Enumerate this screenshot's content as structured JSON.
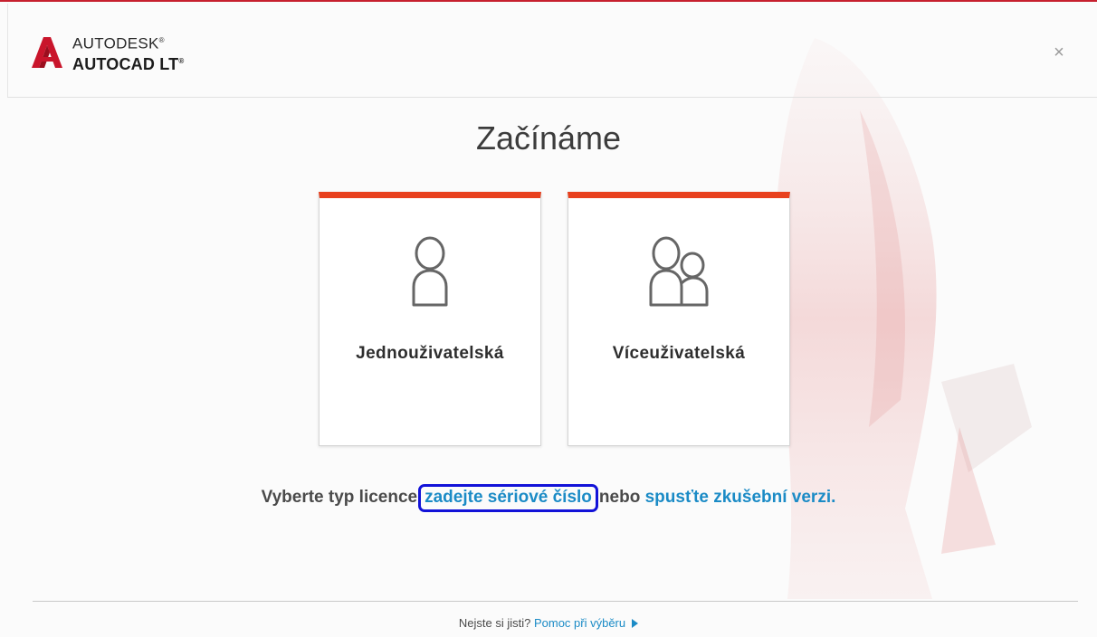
{
  "window": {
    "accent_color": "#c7202f",
    "close_icon": "close-icon",
    "close_glyph": "×"
  },
  "brand": {
    "company": "AUTODESK",
    "product": "AUTOCAD LT",
    "trademark": "®",
    "logo_icon": "autodesk-a-logo-icon"
  },
  "page": {
    "title": "Začínáme"
  },
  "cards": [
    {
      "id": "single",
      "label": "Jednouživatelská",
      "icon": "single-user-icon",
      "accent_color": "#e8401d"
    },
    {
      "id": "multi",
      "label": "Víceuživatelská",
      "icon": "multi-user-icon",
      "accent_color": "#e8401d"
    }
  ],
  "license": {
    "prefix": "Vyberte typ licence",
    "serial_link": "zadejte sériové číslo",
    "middle": "nebo",
    "trial_link": "spusťte zkušební verzi",
    "suffix": ".",
    "link_color": "#1b8bc6",
    "highlight_color": "#1212d8"
  },
  "footer": {
    "question": "Nejste si jisti?",
    "help_link": "Pomoc při výběru",
    "arrow_icon": "arrow-right-icon"
  }
}
